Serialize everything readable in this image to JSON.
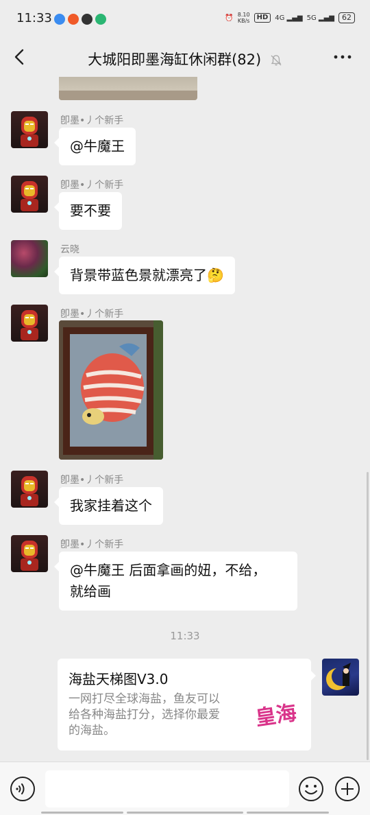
{
  "status_bar": {
    "time": "11:33",
    "speed_value": "8.10",
    "speed_unit": "KB/s",
    "hd": "HD",
    "net1": "4G",
    "net2": "5G",
    "battery": "62"
  },
  "header": {
    "title": "大城阳即墨海缸休闲群(82)"
  },
  "messages": [
    {
      "sender": "卽墨•丿个新手",
      "text": "@牛魔王"
    },
    {
      "sender": "卽墨•丿个新手",
      "text": "要不要"
    },
    {
      "sender": "云晓",
      "text": "背景带蓝色景就漂亮了🤔"
    },
    {
      "sender": "卽墨•丿个新手"
    },
    {
      "sender": "卽墨•丿个新手",
      "text": "我家挂着这个"
    },
    {
      "sender": "卽墨•丿个新手",
      "line1": "@牛魔王  后面拿画的妞，不给，",
      "line2": "就给画"
    }
  ],
  "timestamp": "11:33",
  "share_card": {
    "title": "海盐天梯图V3.0",
    "desc_lines": [
      "一网打尽全球海盐，鱼友可以",
      "给各种海盐打分，选择你最爱",
      "的海盐。"
    ],
    "logo_text": "皇海"
  },
  "icons": {
    "back": "back-arrow-icon",
    "mute": "bell-muted-icon",
    "more": "more-dots-icon",
    "voice": "voice-icon",
    "emoji": "emoji-icon",
    "plus": "plus-icon"
  }
}
